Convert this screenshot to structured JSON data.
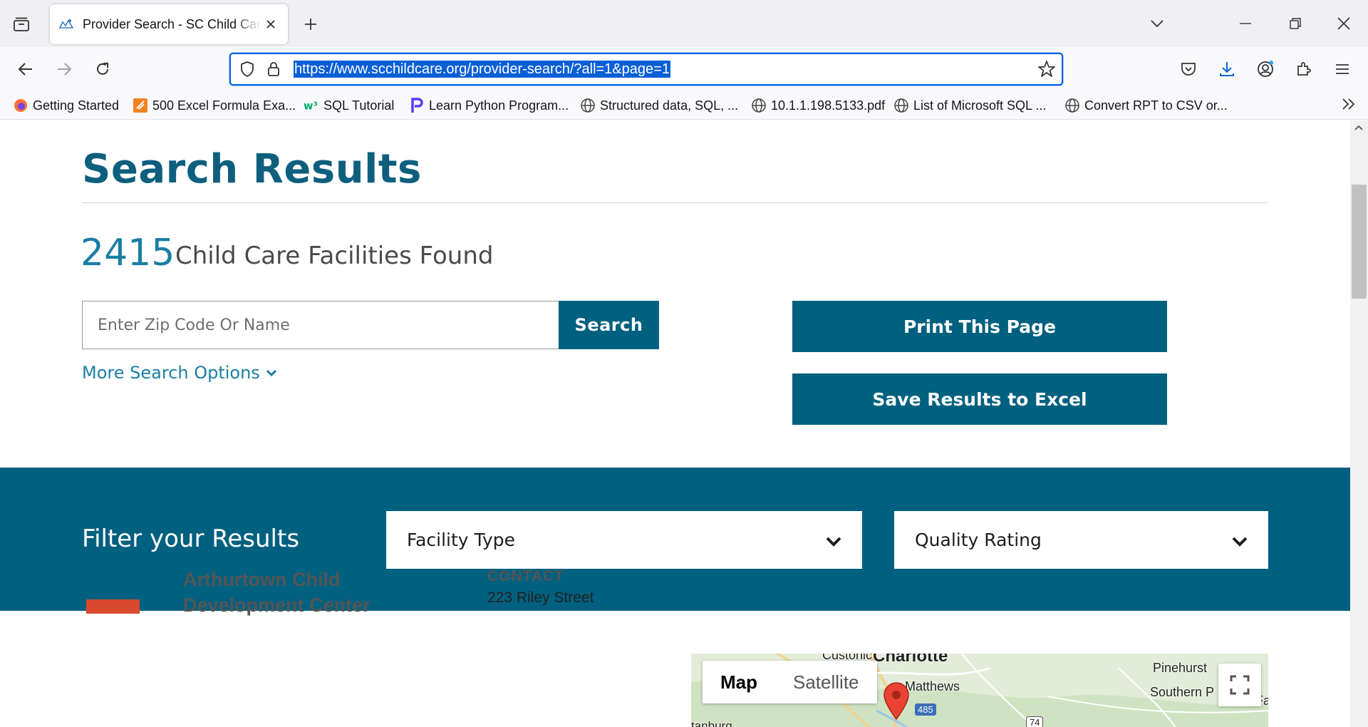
{
  "browser": {
    "tab_title": "Provider Search - SC Child Care",
    "url": "https://www.scchildcare.org/provider-search/?all=1&page=1",
    "bookmarks": [
      {
        "label": "Getting Started",
        "icon": "firefox-icon"
      },
      {
        "label": "500 Excel Formula Exa...",
        "icon": "excel-site-icon"
      },
      {
        "label": "SQL Tutorial",
        "icon": "w3schools-icon"
      },
      {
        "label": "Learn Python Program...",
        "icon": "programiz-icon"
      },
      {
        "label": "Structured data, SQL, ...",
        "icon": "globe-icon"
      },
      {
        "label": "10.1.1.198.5133.pdf",
        "icon": "globe-icon"
      },
      {
        "label": "List of Microsoft SQL ...",
        "icon": "globe-icon"
      },
      {
        "label": "Convert RPT to CSV or...",
        "icon": "globe-icon"
      }
    ]
  },
  "page": {
    "heading": "Search Results",
    "count": "2415",
    "count_label": "Child Care Facilities Found",
    "search": {
      "placeholder": "Enter Zip Code Or Name",
      "button": "Search",
      "more_options": "More Search Options"
    },
    "actions": {
      "print": "Print This Page",
      "excel": "Save Results to Excel"
    },
    "filter": {
      "title": "Filter your Results",
      "facility_type": "Facility Type",
      "quality_rating": "Quality Rating"
    },
    "provider": {
      "name_line1": "Arthurtown Child",
      "name_line2": "Development Center",
      "contact_label": "CONTACT",
      "street": "223 Riley Street"
    },
    "map": {
      "map_label": "Map",
      "satellite_label": "Satellite",
      "places": [
        "Charlotte",
        "Matthews",
        "Pinehurst",
        "Southern P",
        "Fa",
        "tanburg"
      ],
      "road_shields": [
        "485",
        "74"
      ]
    }
  },
  "colors": {
    "brand_teal": "#00607f",
    "heading_teal": "#0e5f7e",
    "link_blue": "#1a7ea5",
    "provider_logo": "#d9492e",
    "url_highlight": "#0a5fd6"
  }
}
